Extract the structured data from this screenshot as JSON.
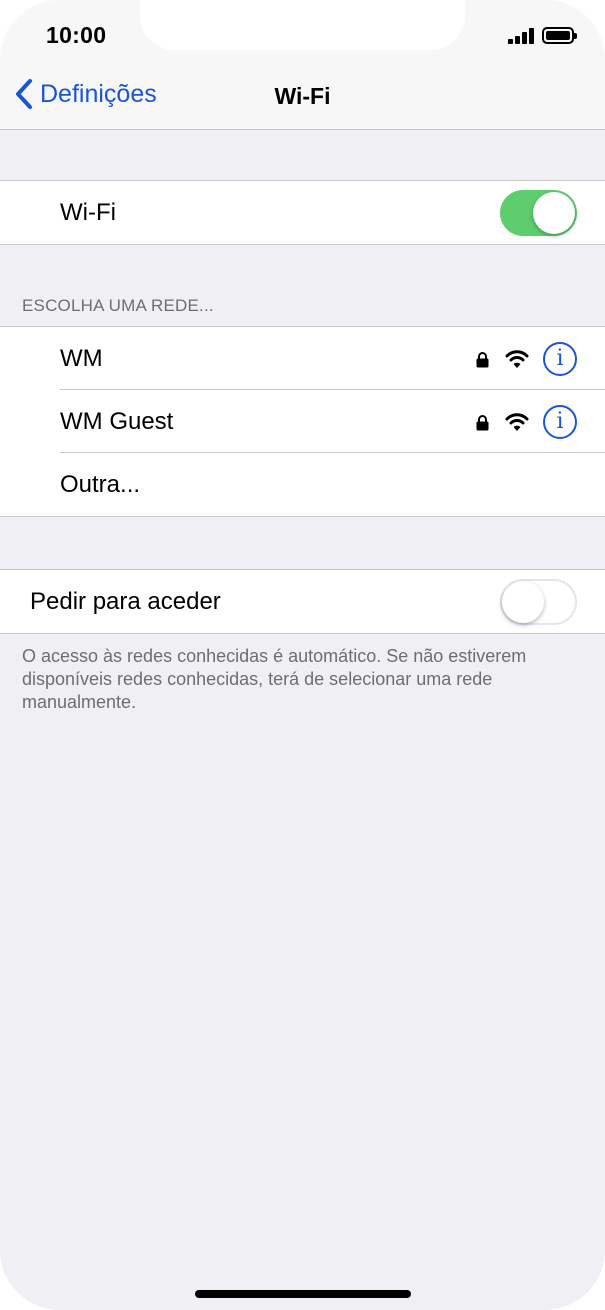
{
  "status_bar": {
    "time": "10:00"
  },
  "nav": {
    "back_label": "Definições",
    "title": "Wi-Fi"
  },
  "wifi_toggle": {
    "label": "Wi-Fi",
    "state": "on"
  },
  "networks_section": {
    "header": "ESCOLHA UMA REDE...",
    "networks": [
      {
        "name": "WM",
        "secured": true,
        "icon": "wifi-icon"
      },
      {
        "name": "WM Guest",
        "secured": true,
        "icon": "wifi-icon"
      }
    ],
    "other_label": "Outra..."
  },
  "ask_to_join": {
    "label": "Pedir para aceder",
    "state": "off",
    "footer": "O acesso às redes conhecidas é automático. Se não estiverem disponíveis redes conhecidas, terá de selecionar uma rede manualmente."
  },
  "colors": {
    "accent": "#1a55d6",
    "toggle_on": "#5dcd6e",
    "background": "#efeff4",
    "secondary_text": "#6d6d72"
  }
}
